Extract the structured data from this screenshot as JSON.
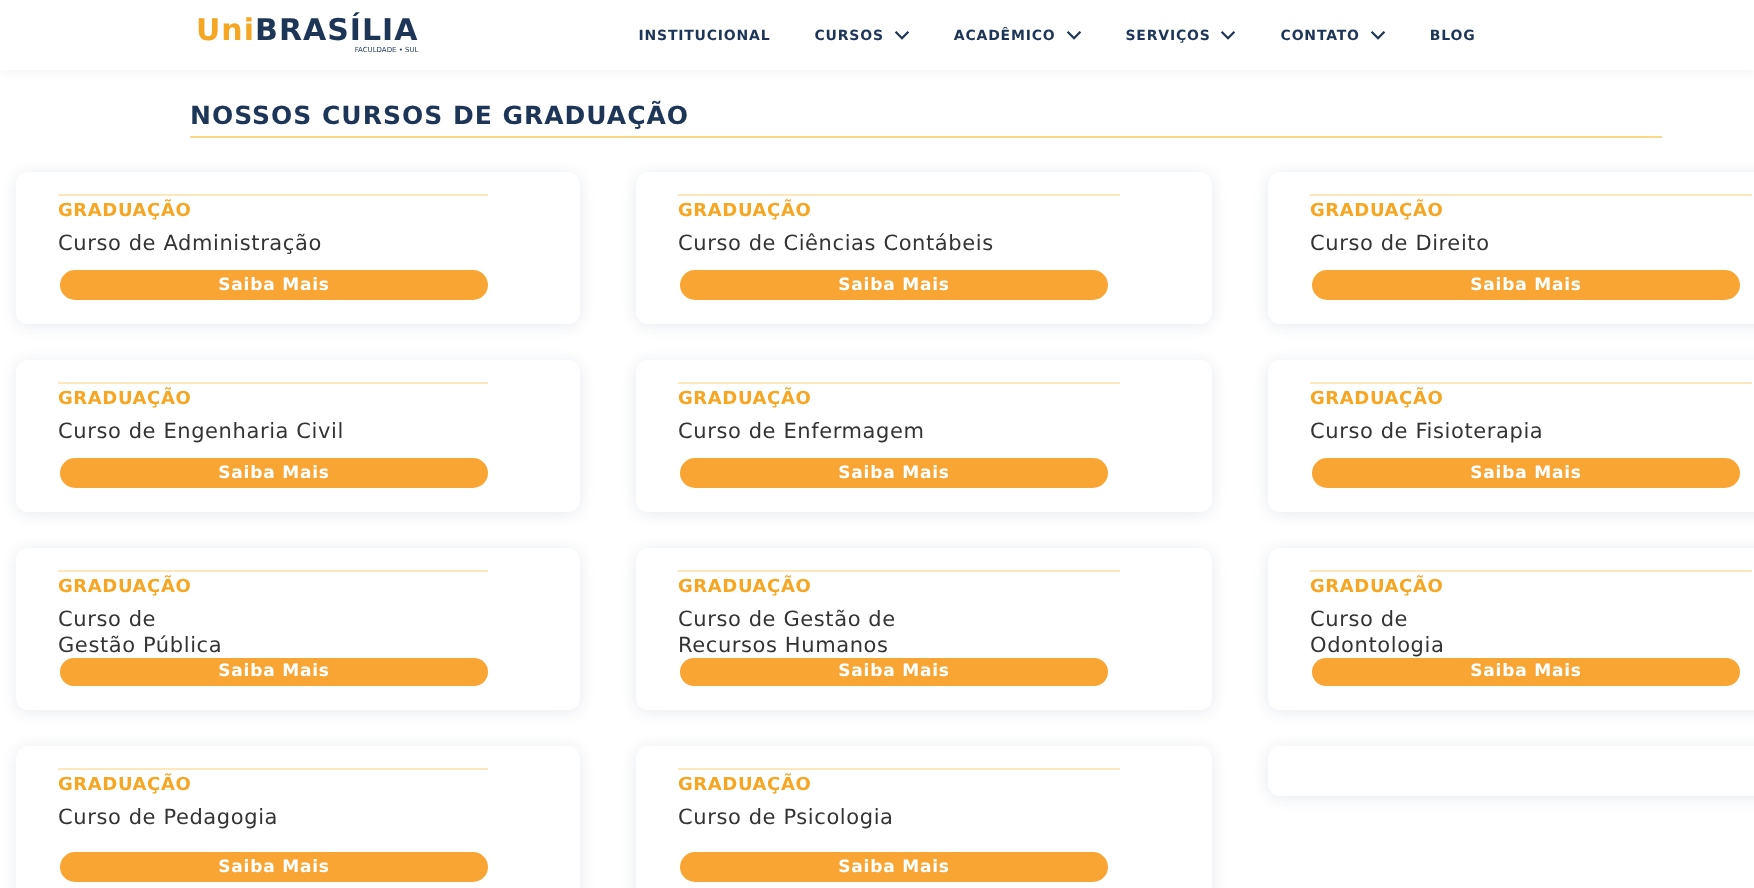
{
  "header": {
    "logo": {
      "prefix": "Uni",
      "name": "BRASÍLIA",
      "tagline": "FACULDADE • SUL"
    },
    "nav": [
      {
        "label": "INSTITUCIONAL",
        "dropdown": false
      },
      {
        "label": "CURSOS",
        "dropdown": true
      },
      {
        "label": "ACADÊMICO",
        "dropdown": true
      },
      {
        "label": "SERVIÇOS",
        "dropdown": true
      },
      {
        "label": "CONTATO",
        "dropdown": true
      },
      {
        "label": "BLOG",
        "dropdown": false
      }
    ]
  },
  "section_title": "NOSSOS CURSOS DE GRADUAÇÃO",
  "courses": [
    {
      "category": "GRADUAÇÃO",
      "title": "Curso de Administração",
      "button": "Saiba Mais"
    },
    {
      "category": "GRADUAÇÃO",
      "title": "Curso de Ciências Contábeis",
      "button": "Saiba Mais"
    },
    {
      "category": "GRADUAÇÃO",
      "title": "Curso de Direito",
      "button": "Saiba Mais"
    },
    {
      "category": "GRADUAÇÃO",
      "title": "Curso de Engenharia Civil",
      "button": "Saiba Mais"
    },
    {
      "category": "GRADUAÇÃO",
      "title": "Curso de Enfermagem",
      "button": "Saiba Mais"
    },
    {
      "category": "GRADUAÇÃO",
      "title": "Curso de Fisioterapia",
      "button": "Saiba Mais"
    },
    {
      "category": "GRADUAÇÃO",
      "title": "Curso de\nGestão Pública",
      "button": "Saiba Mais"
    },
    {
      "category": "GRADUAÇÃO",
      "title": "Curso de Gestão de\nRecursos Humanos",
      "button": "Saiba Mais"
    },
    {
      "category": "GRADUAÇÃO",
      "title": "Curso de\nOdontologia",
      "button": "Saiba Mais"
    },
    {
      "category": "GRADUAÇÃO",
      "title": "Curso de Pedagogia",
      "button": "Saiba Mais"
    },
    {
      "category": "GRADUAÇÃO",
      "title": "Curso de Psicologia",
      "button": "Saiba Mais"
    },
    {
      "kind": "empty"
    }
  ]
}
